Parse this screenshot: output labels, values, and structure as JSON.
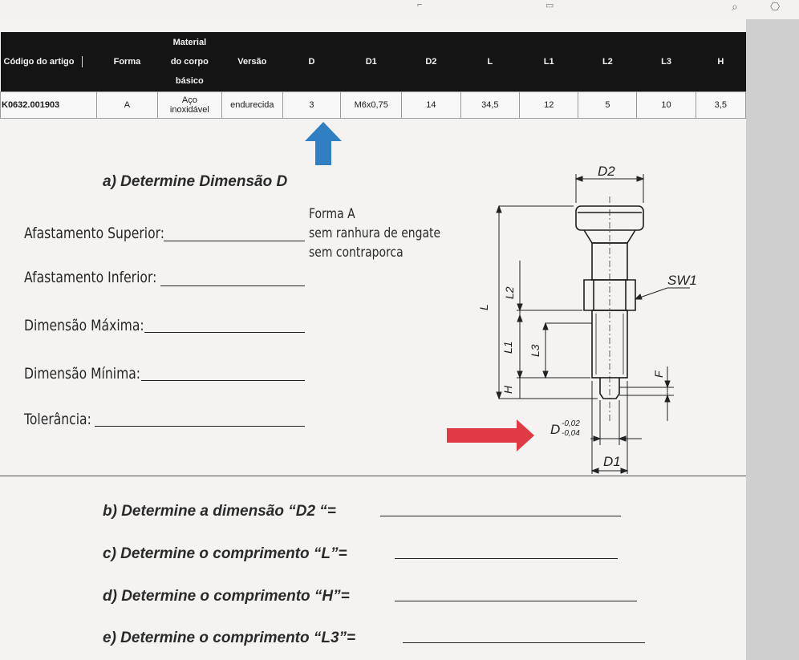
{
  "table": {
    "headers": [
      "Código do artigo",
      "Forma",
      "Material do corpo básico",
      "Versão",
      "D",
      "D1",
      "D2",
      "L",
      "L1",
      "L2",
      "L3",
      "H"
    ],
    "material_lines": [
      "Material",
      "do corpo",
      "básico"
    ],
    "row": {
      "codigo": "K0632.001903",
      "forma": "A",
      "material_lines": [
        "Aço",
        "inoxidável"
      ],
      "versao": "endurecida",
      "d": "3",
      "d1": "M6x0,75",
      "d2": "14",
      "l": "34,5",
      "l1": "12",
      "l2": "5",
      "l3": "10",
      "h": "3,5"
    }
  },
  "section_a": {
    "title": "a) Determine Dimensão D",
    "forma_lines": [
      "Forma A",
      "sem ranhura de engate",
      "sem contraporca"
    ],
    "fields": [
      "Afastamento Superior:",
      "Afastamento Inferior:",
      "Dimensão Máxima:",
      "Dimensão Mínima:",
      "Tolerância:"
    ]
  },
  "drawing": {
    "labels": {
      "d2": "D2",
      "sw1": "SW1",
      "l": "L",
      "l2": "L2",
      "l1": "L1",
      "l3": "L3",
      "h": "H",
      "f": "F",
      "d": "D",
      "d_upper": "-0,02",
      "d_lower": "-0,04",
      "d1": "D1"
    }
  },
  "questions": [
    "b) Determine a dimensão “D2 “=",
    "c) Determine o comprimento “L”=",
    "d) Determine o comprimento “H”=",
    "e) Determine o comprimento “L3”="
  ],
  "colors": {
    "header_bg": "#141414",
    "up_arrow": "#2f7fc2",
    "right_arrow": "#e13a44"
  }
}
